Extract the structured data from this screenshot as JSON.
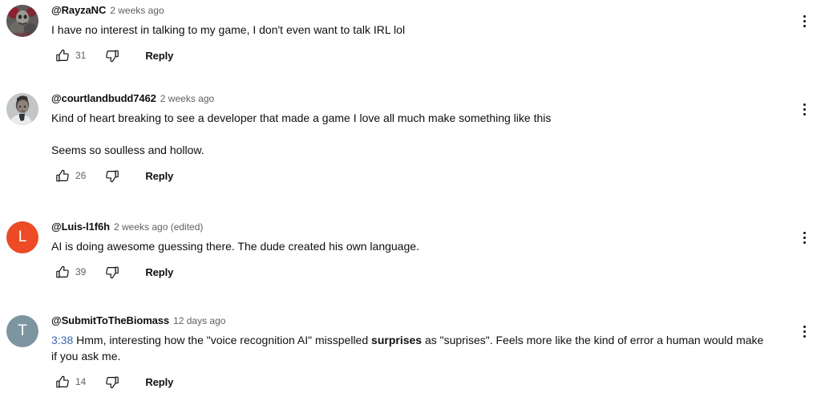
{
  "page": {
    "title": "YouTube comments section"
  },
  "labels": {
    "reply": "Reply",
    "like_icon": "thumbs-up-outline",
    "dislike_icon": "thumbs-down-outline",
    "menu_icon": "more-vertical-icon"
  },
  "comments": [
    {
      "author": "@RayzaNC",
      "published": "2 weeks ago",
      "text": "I have no interest in talking to my game, I don't even want to talk IRL lol",
      "likes": "31",
      "reply": "Reply",
      "avatar": {
        "type": "image",
        "letter": "",
        "color": "#6f5560"
      }
    },
    {
      "author": "@courtlandbudd7462",
      "published": "2 weeks ago",
      "text": "Kind of heart breaking to see a developer that made a game I love all much make something like this\n\nSeems so soulless and hollow.",
      "likes": "26",
      "reply": "Reply",
      "avatar": {
        "type": "image",
        "letter": "",
        "color": "#b9bcbd"
      }
    },
    {
      "author": "@Luis-l1f6h",
      "published": "2 weeks ago (edited)",
      "text": "AI is doing awesome guessing there. The dude created his own language.",
      "likes": "39",
      "reply": "Reply",
      "avatar": {
        "type": "letter",
        "letter": "L",
        "color": "#ec4b26"
      }
    },
    {
      "author": "@SubmitToTheBiomass",
      "published": "12 days ago",
      "text_parts": [
        {
          "kind": "link",
          "value": "3:38"
        },
        {
          "kind": "plain",
          "value": " Hmm, interesting how the \"voice recognition AI\" misspelled "
        },
        {
          "kind": "bold",
          "value": "surprises"
        },
        {
          "kind": "plain",
          "value": " as \"suprises\". Feels more like the kind of error a human would make if you ask me."
        }
      ],
      "likes": "14",
      "reply": "Reply",
      "avatar": {
        "type": "letter",
        "letter": "T",
        "color": "#7d95a1"
      }
    }
  ],
  "colors": {
    "text_primary": "#0f0f0f",
    "text_secondary": "#606060",
    "link_blue": "#3b69b0",
    "background": "#ffffff"
  }
}
